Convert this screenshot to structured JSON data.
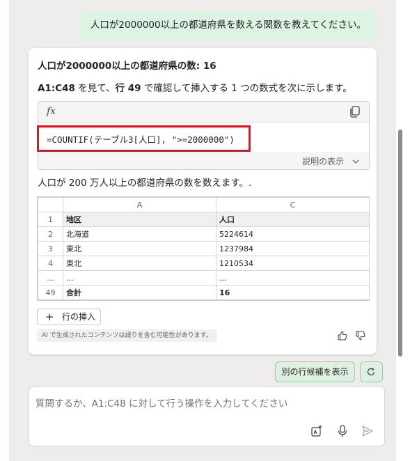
{
  "user_message": "人口が2000000以上の都道府県を数える関数を教えてください。",
  "response": {
    "title": "人口が2000000以上の都道府県の数: 16",
    "desc_prefix": "A1:C48",
    "desc_part1": " を見て、",
    "desc_bold": "行 49",
    "desc_part2": " で確認して挿入する 1 つの数式を次に示します。",
    "formula": "=COUNTIF(テーブル3[人口], \">=2000000\")",
    "explain_label": "説明の表示",
    "summary": "人口が 200 万人以上の都道府県の数を数えます。."
  },
  "sheet": {
    "col_headers": [
      "A",
      "C"
    ],
    "rows": [
      {
        "num": "1",
        "a": "地区",
        "c": "人口"
      },
      {
        "num": "2",
        "a": "北海道",
        "c": "5224614"
      },
      {
        "num": "3",
        "a": "東北",
        "c": "1237984"
      },
      {
        "num": "4",
        "a": "東北",
        "c": "1210534"
      },
      {
        "num": "...",
        "a": "...",
        "c": "..."
      },
      {
        "num": "49",
        "a": "合計",
        "c": "16"
      }
    ]
  },
  "insert_row_label": "行の挿入",
  "disclaimer": "AI で生成されたコンテンツは誤りを含む可能性があります。",
  "suggest_label": "別の行候補を表示",
  "input_placeholder": "質問するか、A1:C48 に対して行う操作を入力してください",
  "icons": [
    "fx-icon",
    "copy-icon",
    "plus-icon",
    "thumbs-up-icon",
    "thumbs-down-icon",
    "refresh-icon",
    "sparkle-icon",
    "microphone-icon",
    "send-icon"
  ],
  "colors": {
    "accent_green": "#ddf3e4",
    "highlight_red": "#e0141e"
  }
}
